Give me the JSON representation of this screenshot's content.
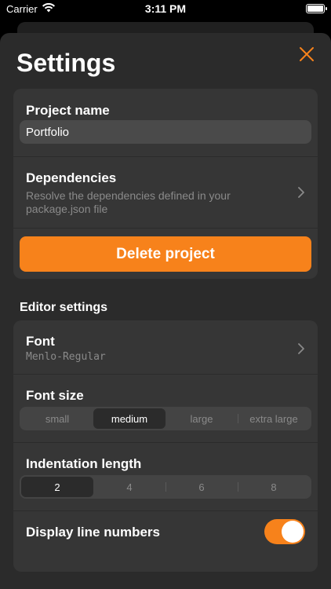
{
  "status": {
    "carrier": "Carrier",
    "time": "3:11 PM"
  },
  "header": {
    "title": "Settings"
  },
  "project": {
    "name_label": "Project name",
    "name_value": "Portfolio",
    "dependencies_label": "Dependencies",
    "dependencies_desc_line1": "Resolve the dependencies defined in your",
    "dependencies_desc_line2": "package.json file",
    "delete_label": "Delete project"
  },
  "editor": {
    "section_title": "Editor settings",
    "font_label": "Font",
    "font_value": "Menlo-Regular",
    "font_size_label": "Font size",
    "font_sizes": [
      "small",
      "medium",
      "large",
      "extra large"
    ],
    "font_size_selected": "medium",
    "indentation_label": "Indentation length",
    "indentations": [
      "2",
      "4",
      "6",
      "8"
    ],
    "indentation_selected": "2",
    "line_numbers_label": "Display line numbers",
    "line_numbers_on": true
  },
  "colors": {
    "accent": "#f7821b",
    "sheet": "#2b2b2b",
    "card": "#363636"
  }
}
